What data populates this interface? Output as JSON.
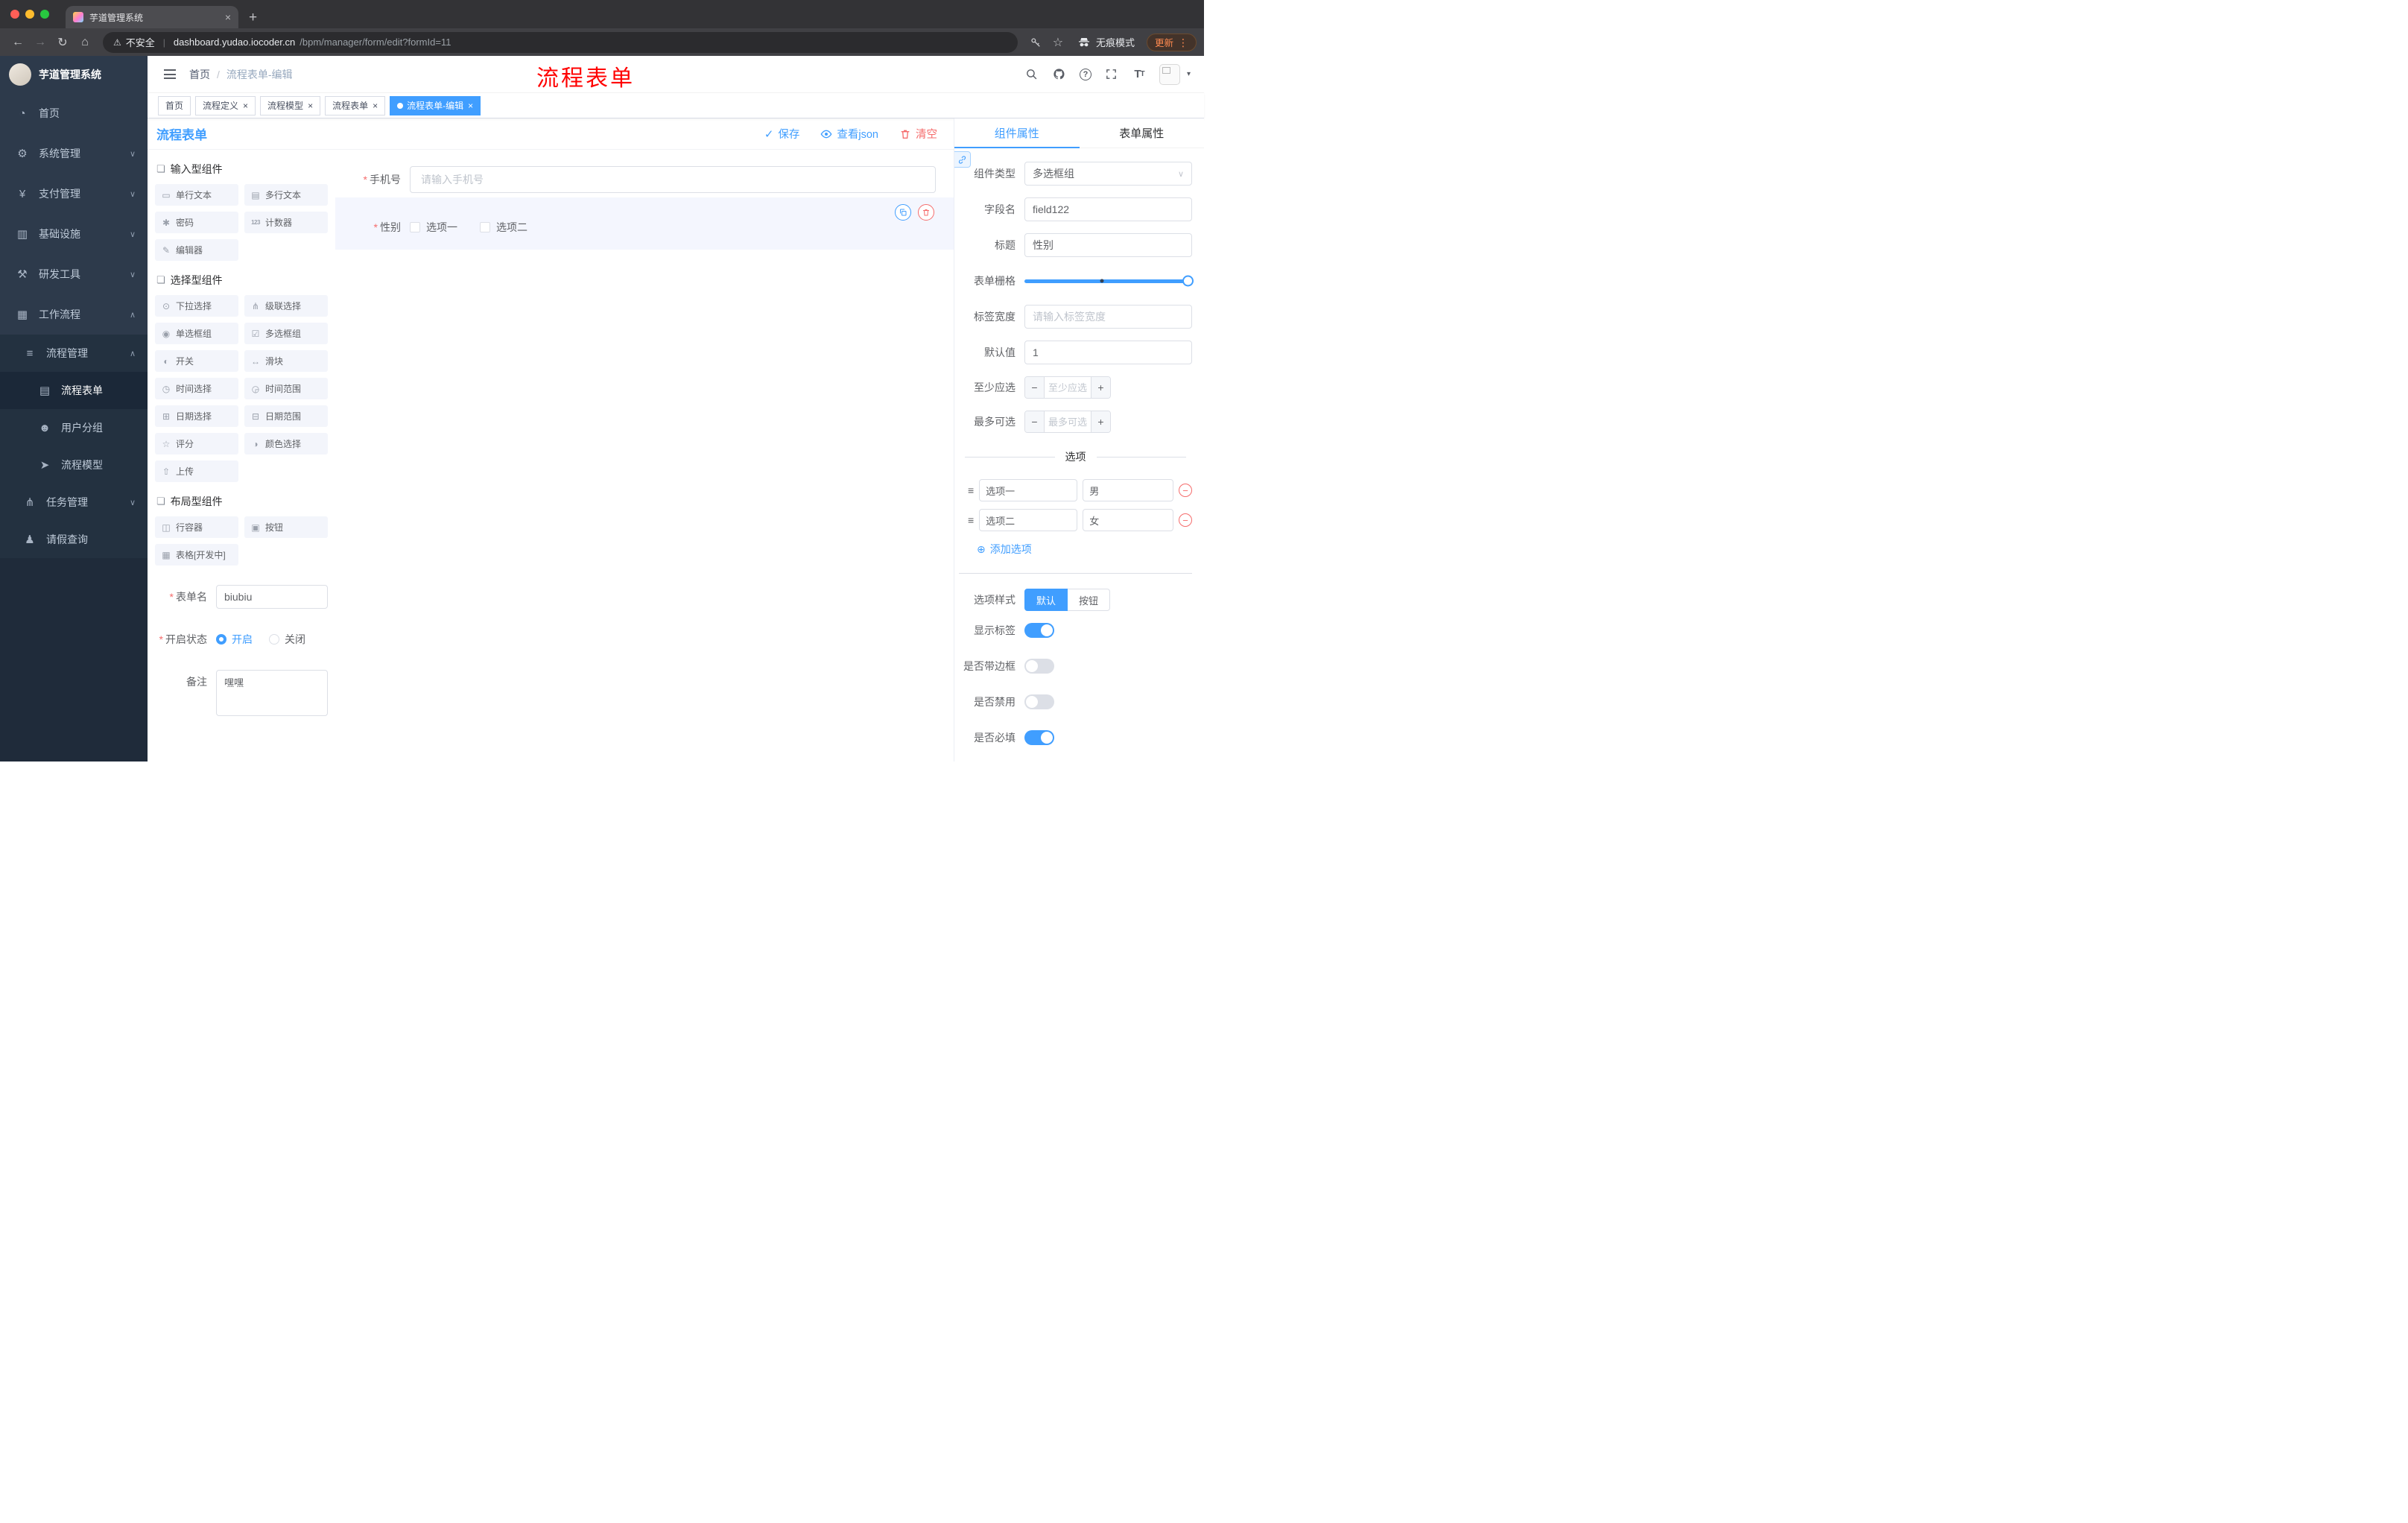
{
  "colors": {
    "primary": "#409eff",
    "danger": "#f56c6c",
    "sidebar_bg": "#2d3a4b",
    "tag_active": "#409eff",
    "annotation": "#ff0000"
  },
  "annotation": {
    "text": "流程表单"
  },
  "browser": {
    "tab": {
      "title": "芋道管理系统"
    },
    "toolbar": {
      "security_label": "不安全",
      "url_domain": "dashboard.yudao.iocoder.cn",
      "url_path": "/bpm/manager/form/edit?formId=11",
      "incognito_label": "无痕模式",
      "update_label": "更新"
    }
  },
  "sidebar": {
    "logo_title": "芋道管理系统",
    "menu": [
      {
        "id": "home",
        "label": "首页",
        "icon": "dashboard-icon",
        "glyph": "◔"
      },
      {
        "id": "system",
        "label": "系统管理",
        "icon": "gear-icon",
        "glyph": "⚙",
        "arrow": "down"
      },
      {
        "id": "payment",
        "label": "支付管理",
        "icon": "payment-icon",
        "glyph": "¥",
        "arrow": "down"
      },
      {
        "id": "infrastructure",
        "label": "基础设施",
        "icon": "infrastructure-icon",
        "glyph": "▥",
        "arrow": "down"
      },
      {
        "id": "devtools",
        "label": "研发工具",
        "icon": "tools-icon",
        "glyph": "⚒",
        "arrow": "down"
      },
      {
        "id": "workflow",
        "label": "工作流程",
        "icon": "workflow-icon",
        "glyph": "▦",
        "arrow": "up",
        "expanded": true
      }
    ],
    "submenu": [
      {
        "id": "process-management",
        "label": "流程管理",
        "level": 2,
        "icon": "list-icon",
        "glyph": "≡",
        "arrow": "up"
      },
      {
        "id": "process-form",
        "label": "流程表单",
        "level": 3,
        "icon": "form-icon",
        "glyph": "▤",
        "active": true
      },
      {
        "id": "user-group",
        "label": "用户分组",
        "level": 3,
        "icon": "user-group-icon",
        "glyph": "☻"
      },
      {
        "id": "process-model",
        "label": "流程模型",
        "level": 3,
        "icon": "paper-plane-icon",
        "glyph": "➤"
      },
      {
        "id": "task-management",
        "label": "任务管理",
        "level": 2,
        "icon": "task-tree-icon",
        "glyph": "⋔",
        "arrow": "down"
      },
      {
        "id": "leave-query",
        "label": "请假查询",
        "level": 2,
        "icon": "person-icon",
        "glyph": "♟"
      }
    ]
  },
  "header": {
    "breadcrumb": [
      "首页",
      "流程表单-编辑"
    ]
  },
  "tagbar": [
    {
      "id": "home",
      "label": "首页",
      "closable": false,
      "active": false
    },
    {
      "id": "process-definition",
      "label": "流程定义",
      "closable": true,
      "active": false
    },
    {
      "id": "process-model",
      "label": "流程模型",
      "closable": true,
      "active": false
    },
    {
      "id": "process-form",
      "label": "流程表单",
      "closable": true,
      "active": false
    },
    {
      "id": "process-form-edit",
      "label": "流程表单-编辑",
      "closable": true,
      "active": true
    }
  ],
  "designer": {
    "title": "流程表单",
    "actions": {
      "save": "保存",
      "view_json": "查看json",
      "clear": "清空"
    },
    "palette": {
      "groups": [
        {
          "title": "输入型组件",
          "items": [
            {
              "id": "single-line-text",
              "label": "单行文本",
              "icon": "text-field-icon",
              "glyph": "▭"
            },
            {
              "id": "multi-line-text",
              "label": "多行文本",
              "icon": "textarea-icon",
              "glyph": "▤"
            },
            {
              "id": "password",
              "label": "密码",
              "icon": "lock-icon",
              "glyph": "✱"
            },
            {
              "id": "counter",
              "label": "计数器",
              "icon": "counter-icon",
              "glyph": "123"
            },
            {
              "id": "editor",
              "label": "编辑器",
              "icon": "editor-icon",
              "glyph": "✎"
            }
          ]
        },
        {
          "title": "选择型组件",
          "items": [
            {
              "id": "select",
              "label": "下拉选择",
              "icon": "select-icon",
              "glyph": "⊙"
            },
            {
              "id": "cascader",
              "label": "级联选择",
              "icon": "cascader-icon",
              "glyph": "⋔"
            },
            {
              "id": "radio-group",
              "label": "单选框组",
              "icon": "radio-icon",
              "glyph": "◉"
            },
            {
              "id": "checkbox-group",
              "label": "多选框组",
              "icon": "checkbox-icon",
              "glyph": "☑"
            },
            {
              "id": "switch",
              "label": "开关",
              "icon": "switch-icon",
              "glyph": "◐"
            },
            {
              "id": "slider",
              "label": "滑块",
              "icon": "slider-icon",
              "glyph": "↔"
            },
            {
              "id": "time-picker",
              "label": "时间选择",
              "icon": "clock-icon",
              "glyph": "◷"
            },
            {
              "id": "time-range",
              "label": "时间范围",
              "icon": "clock-range-icon",
              "glyph": "◶"
            },
            {
              "id": "date-picker",
              "label": "日期选择",
              "icon": "calendar-icon",
              "glyph": "⊞"
            },
            {
              "id": "date-range",
              "label": "日期范围",
              "icon": "calendar-range-icon",
              "glyph": "⊟"
            },
            {
              "id": "rate",
              "label": "评分",
              "icon": "star-icon",
              "glyph": "☆"
            },
            {
              "id": "color-picker",
              "label": "颜色选择",
              "icon": "color-icon",
              "glyph": "◑"
            },
            {
              "id": "upload",
              "label": "上传",
              "icon": "upload-icon",
              "glyph": "⇧"
            }
          ]
        },
        {
          "title": "布局型组件",
          "items": [
            {
              "id": "row-container",
              "label": "行容器",
              "icon": "row-container-icon",
              "glyph": "◫"
            },
            {
              "id": "button",
              "label": "按钮",
              "icon": "button-icon",
              "glyph": "▣"
            },
            {
              "id": "table",
              "label": "表格[开发中]",
              "icon": "table-icon",
              "glyph": "▦"
            }
          ]
        }
      ]
    },
    "meta": {
      "form_name": {
        "label": "表单名",
        "required": true,
        "value": "biubiu"
      },
      "status": {
        "label": "开启状态",
        "required": true,
        "options": [
          "开启",
          "关闭"
        ],
        "selected": "开启"
      },
      "remark": {
        "label": "备注",
        "value": "嘿嘿"
      }
    },
    "canvas": {
      "phone": {
        "label": "手机号",
        "required": true,
        "placeholder": "请输入手机号"
      },
      "gender": {
        "label": "性别",
        "required": true,
        "options": [
          "选项一",
          "选项二"
        ],
        "selected": true
      }
    }
  },
  "props": {
    "tabs": [
      "组件属性",
      "表单属性"
    ],
    "active_tab": "组件属性",
    "component_type": {
      "label": "组件类型",
      "value": "多选框组"
    },
    "field_name": {
      "label": "字段名",
      "value": "field122"
    },
    "title": {
      "label": "标题",
      "value": "性别"
    },
    "grid": {
      "label": "表单栅格"
    },
    "label_width": {
      "label": "标签宽度",
      "placeholder": "请输入标签宽度"
    },
    "default_value": {
      "label": "默认值",
      "value": "1"
    },
    "min_select": {
      "label": "至少应选",
      "placeholder": "至少应选"
    },
    "max_select": {
      "label": "最多可选",
      "placeholder": "最多可选"
    },
    "options": {
      "divider": "选项",
      "rows": [
        {
          "label": "选项一",
          "value": "男"
        },
        {
          "label": "选项二",
          "value": "女"
        }
      ],
      "add_label": "添加选项"
    },
    "option_style": {
      "label": "选项样式",
      "choices": [
        "默认",
        "按钮"
      ],
      "selected": "默认"
    },
    "switches": [
      {
        "id": "show-label",
        "label": "显示标签",
        "on": true
      },
      {
        "id": "border",
        "label": "是否带边框",
        "on": false
      },
      {
        "id": "disabled",
        "label": "是否禁用",
        "on": false
      },
      {
        "id": "required",
        "label": "是否必填",
        "on": true
      }
    ]
  }
}
